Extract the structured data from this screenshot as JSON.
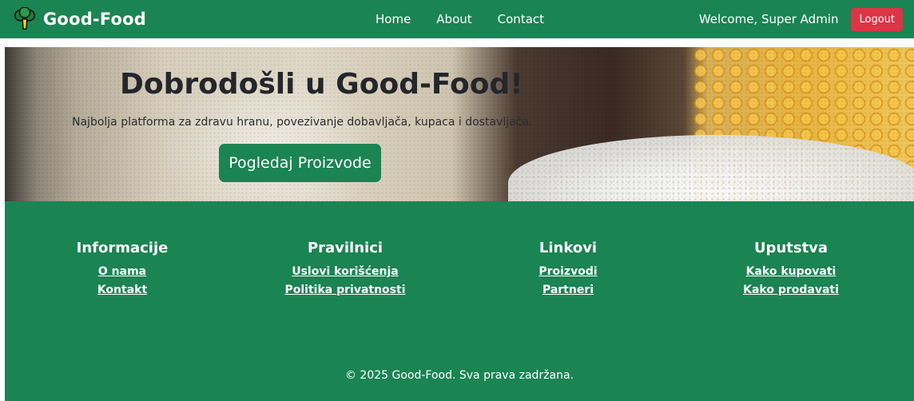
{
  "navbar": {
    "brand": "Good-Food",
    "links": [
      "Home",
      "About",
      "Contact"
    ],
    "welcome": "Welcome, Super Admin",
    "logout": "Logout"
  },
  "hero": {
    "title": "Dobrodošli u Good-Food!",
    "subtitle": "Najbolja platforma za zdravu hranu, povezivanje dobavljača, kupaca i dostavljača.",
    "cta": "Pogledaj Proizvode"
  },
  "footer": {
    "columns": [
      {
        "title": "Informacije",
        "links": [
          "O nama",
          "Kontakt"
        ]
      },
      {
        "title": "Pravilnici",
        "links": [
          "Uslovi korišćenja",
          "Politika privatnosti"
        ]
      },
      {
        "title": "Linkovi",
        "links": [
          "Proizvodi",
          "Partneri"
        ]
      },
      {
        "title": "Uputstva",
        "links": [
          "Kako kupovati",
          "Kako prodavati"
        ]
      }
    ],
    "copyright": "© 2025 Good-Food. Sva prava zadržana."
  },
  "colors": {
    "primary_green": "#1b8453",
    "logout_red": "#dc3545"
  },
  "icons": {
    "brand": "broccoli-icon"
  }
}
